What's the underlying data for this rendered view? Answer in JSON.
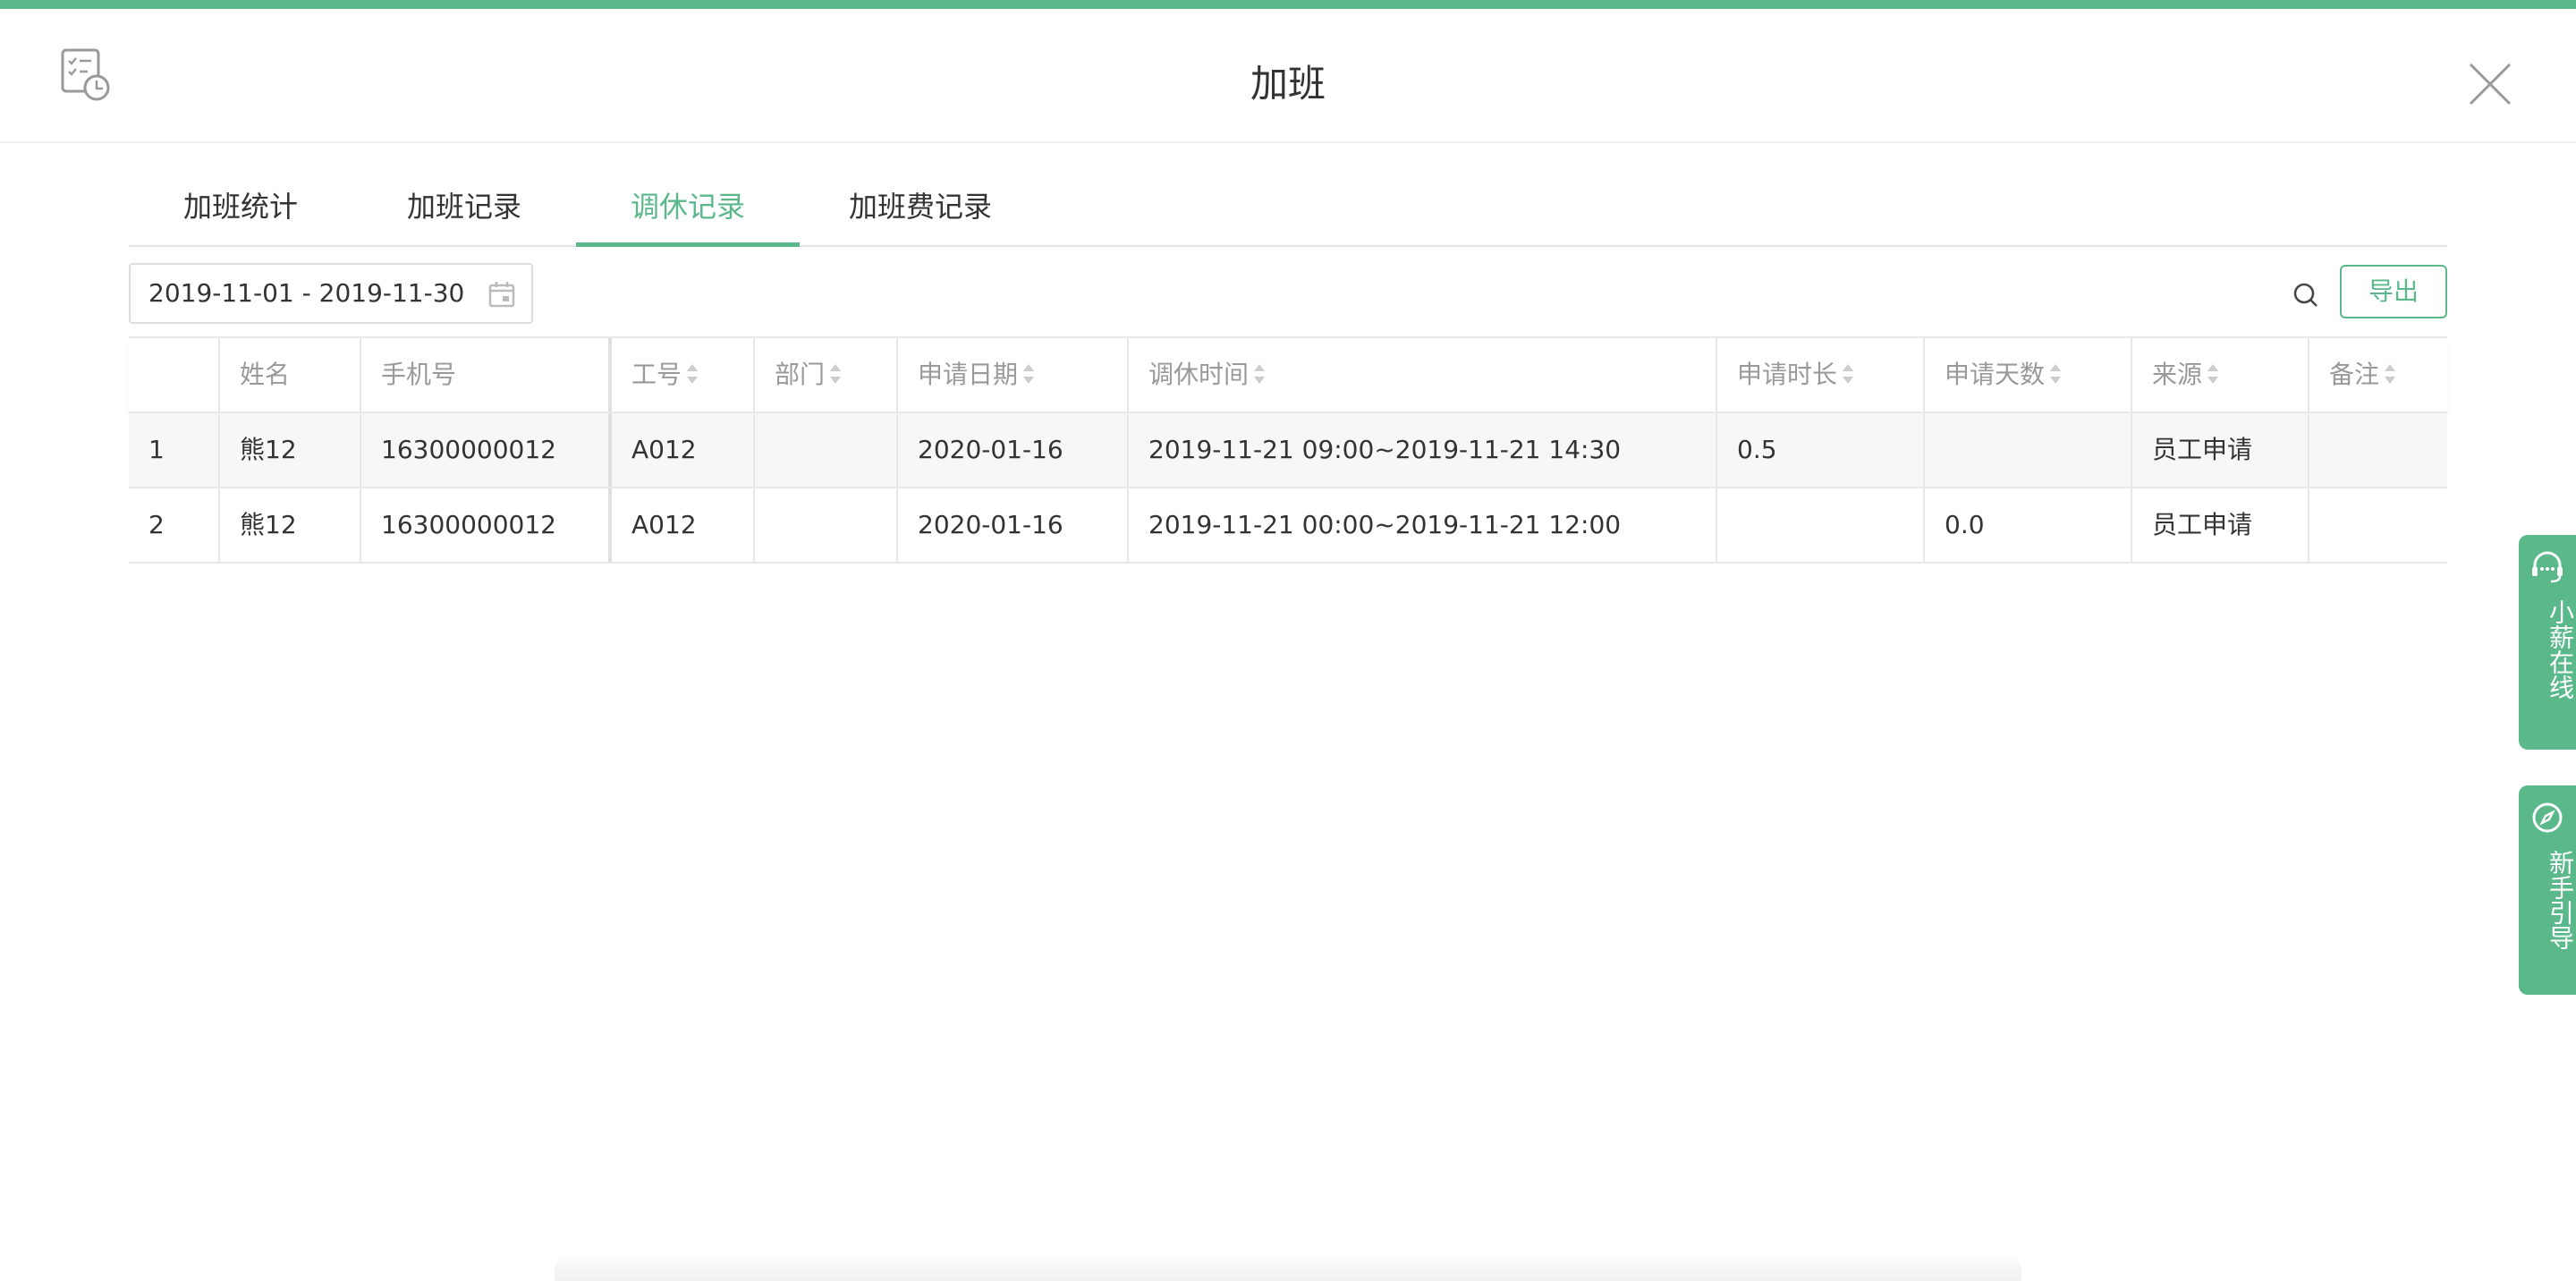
{
  "header": {
    "title": "加班",
    "app_icon": "calendar-clock-icon",
    "close_icon": "close-icon"
  },
  "tabs": [
    {
      "label": "加班统计",
      "active": false
    },
    {
      "label": "加班记录",
      "active": false
    },
    {
      "label": "调休记录",
      "active": true
    },
    {
      "label": "加班费记录",
      "active": false
    }
  ],
  "toolbar": {
    "date_range": "2019-11-01 - 2019-11-30",
    "export_label": "导出"
  },
  "table": {
    "columns": [
      "",
      "姓名",
      "手机号",
      "工号",
      "部门",
      "申请日期",
      "调休时间",
      "申请时长",
      "申请天数",
      "来源",
      "备注"
    ],
    "rows": [
      [
        "1",
        "熊12",
        "16300000012",
        "A012",
        "",
        "2020-01-16",
        "2019-11-21 09:00~2019-11-21 14:30",
        "0.5",
        "",
        "员工申请",
        ""
      ],
      [
        "2",
        "熊12",
        "16300000012",
        "A012",
        "",
        "2020-01-16",
        "2019-11-21 00:00~2019-11-21 12:00",
        "",
        "0.0",
        "员工申请",
        ""
      ]
    ]
  },
  "side_widgets": {
    "online": {
      "label": "小薪在线",
      "icon": "headset-chat-icon"
    },
    "guide": {
      "label": "新手引导",
      "icon": "compass-icon"
    }
  },
  "colors": {
    "accent": "#5ab88a",
    "muted_text": "#999999"
  }
}
